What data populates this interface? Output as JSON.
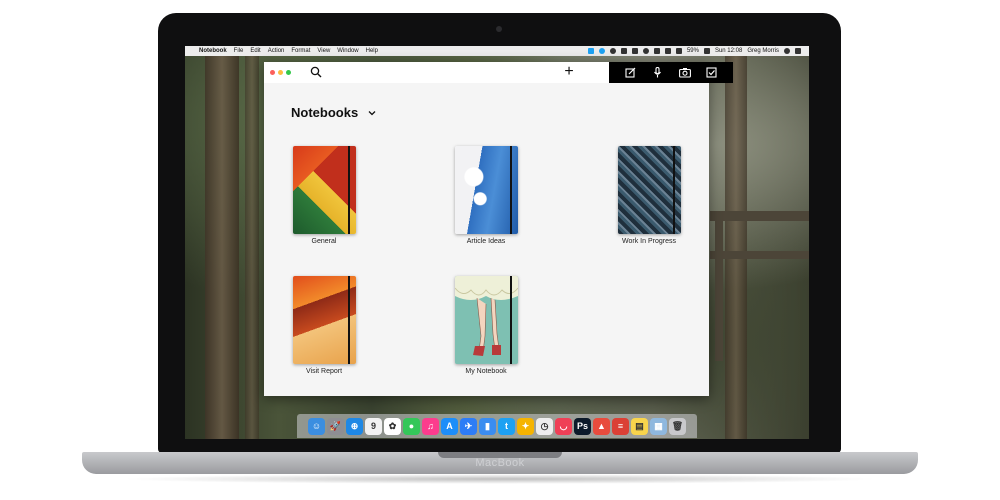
{
  "device": {
    "brand_label": "MacBook"
  },
  "menubar": {
    "apple_glyph": "",
    "menus": [
      {
        "label": "Notebook",
        "bold": true
      },
      {
        "label": "File"
      },
      {
        "label": "Edit"
      },
      {
        "label": "Action"
      },
      {
        "label": "Format"
      },
      {
        "label": "View"
      },
      {
        "label": "Window"
      },
      {
        "label": "Help"
      }
    ],
    "battery": "59%",
    "clock": "Sun 12:08",
    "user": "Greg Morris"
  },
  "window": {
    "traffic_light_colors": [
      "#fc605c",
      "#fdbc40",
      "#34c84a"
    ],
    "toolbar": {
      "plus_label": "+",
      "right_icons": [
        "compose-icon",
        "microphone-icon",
        "camera-icon",
        "checkbox-icon"
      ]
    },
    "title": "Notebooks",
    "notebooks": [
      {
        "label": "General"
      },
      {
        "label": "Article Ideas"
      },
      {
        "label": "Work In Progress"
      },
      {
        "label": "Visit Report"
      },
      {
        "label": "My Notebook"
      }
    ]
  },
  "dock": {
    "icons": [
      {
        "name": "finder-icon",
        "color": "#3b8ee0",
        "glyph": "☺"
      },
      {
        "name": "launchpad-icon",
        "color": "#8e8e93",
        "glyph": "🚀"
      },
      {
        "name": "safari-icon",
        "color": "#1e88e5",
        "glyph": "⊕"
      },
      {
        "name": "calendar-icon",
        "color": "#f2f2f2",
        "glyph": "9"
      },
      {
        "name": "photos-icon",
        "color": "#ffffff",
        "glyph": "✿"
      },
      {
        "name": "messages-icon",
        "color": "#34c759",
        "glyph": "●"
      },
      {
        "name": "itunes-icon",
        "color": "#fc3c8d",
        "glyph": "♫"
      },
      {
        "name": "app-store-icon",
        "color": "#1c8ef9",
        "glyph": "A"
      },
      {
        "name": "airmail-icon",
        "color": "#2d7df6",
        "glyph": "✈"
      },
      {
        "name": "bookmark-icon",
        "color": "#3a8df0",
        "glyph": "▮"
      },
      {
        "name": "twitter-icon",
        "color": "#1da1f2",
        "glyph": "t"
      },
      {
        "name": "tes-icon",
        "color": "#f5b400",
        "glyph": "✦"
      },
      {
        "name": "clock-icon",
        "color": "#eeeeee",
        "glyph": "◷"
      },
      {
        "name": "pocket-icon",
        "color": "#ef4056",
        "glyph": "◡"
      },
      {
        "name": "photoshop-icon",
        "color": "#0c1a2a",
        "glyph": "Ps"
      },
      {
        "name": "notebook-app-icon",
        "color": "#e84c3d",
        "glyph": "▲"
      },
      {
        "name": "todoist-icon",
        "color": "#db4035",
        "glyph": "≡"
      },
      {
        "name": "notes-icon",
        "color": "#f8d44c",
        "glyph": "▤"
      },
      {
        "name": "preview-icon",
        "color": "#8fb8de",
        "glyph": "▦"
      },
      {
        "name": "trash-icon",
        "color": "#c9c9cc",
        "glyph": "🗑"
      }
    ]
  }
}
